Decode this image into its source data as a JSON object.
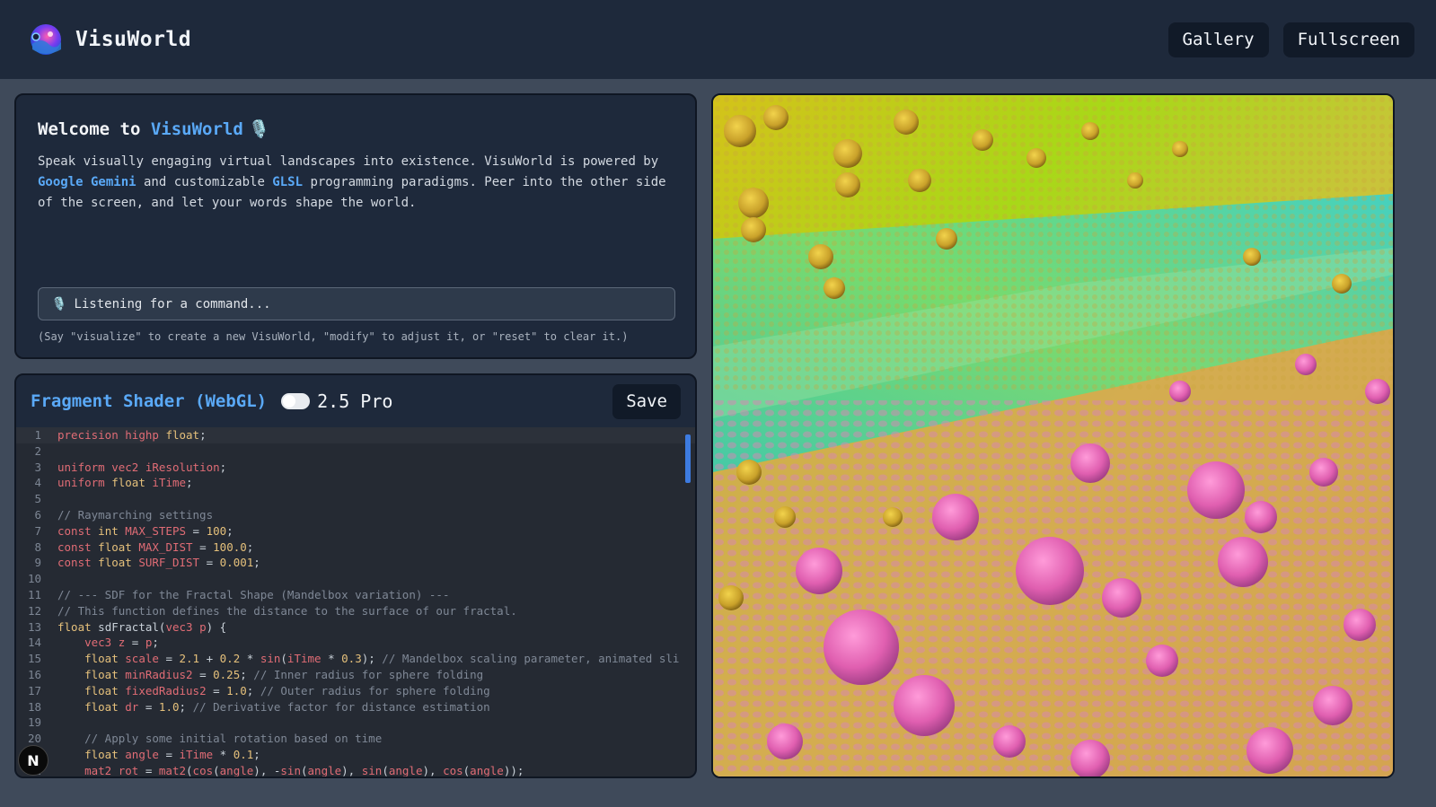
{
  "header": {
    "app_name": "VisuWorld",
    "gallery_label": "Gallery",
    "fullscreen_label": "Fullscreen"
  },
  "welcome": {
    "title_prefix": "Welcome to ",
    "title_accent": "VisuWorld",
    "title_emoji": "🎙️",
    "text_1": "Speak visually engaging virtual landscapes into existence. VisuWorld is powered by ",
    "link_1": "Google Gemini",
    "text_2": " and customizable ",
    "link_2": "GLSL",
    "text_3": " programming paradigms. Peer into the other side of the screen, and let your words shape the world.",
    "status_icon": "🎙️",
    "status_text": "Listening for a command...",
    "hint": "(Say \"visualize\" to create a new VisuWorld, \"modify\" to adjust it, or \"reset\" to clear it.)"
  },
  "editor": {
    "title": "Fragment Shader (WebGL)",
    "model_label": "2.5 Pro",
    "save_label": "Save",
    "lines": [
      {
        "n": "1",
        "html": "<span class='kw'>precision</span> <span class='kw'>highp</span> <span class='ty'>float</span>;"
      },
      {
        "n": "2",
        "html": ""
      },
      {
        "n": "3",
        "html": "<span class='kw'>uniform</span> <span class='kw'>vec2</span> <span class='kw'>iResolution</span>;"
      },
      {
        "n": "4",
        "html": "<span class='kw'>uniform</span> <span class='ty'>float</span> <span class='kw'>iTime</span>;"
      },
      {
        "n": "5",
        "html": ""
      },
      {
        "n": "6",
        "html": "<span class='cm'>// Raymarching settings</span>"
      },
      {
        "n": "7",
        "html": "<span class='kw'>const</span> <span class='ty'>int</span> <span class='kw'>MAX_STEPS</span> = <span class='nm'>100</span>;"
      },
      {
        "n": "8",
        "html": "<span class='kw'>const</span> <span class='ty'>float</span> <span class='kw'>MAX_DIST</span> = <span class='nm'>100.0</span>;"
      },
      {
        "n": "9",
        "html": "<span class='kw'>const</span> <span class='ty'>float</span> <span class='kw'>SURF_DIST</span> = <span class='nm'>0.001</span>;"
      },
      {
        "n": "10",
        "html": ""
      },
      {
        "n": "11",
        "html": "<span class='cm'>// --- SDF for the Fractal Shape (Mandelbox variation) ---</span>"
      },
      {
        "n": "12",
        "html": "<span class='cm'>// This function defines the distance to the surface of our fractal.</span>"
      },
      {
        "n": "13",
        "html": "<span class='ty'>float</span> sdFractal(<span class='kw'>vec3</span> <span class='kw'>p</span>) {"
      },
      {
        "n": "14",
        "html": "    <span class='kw'>vec3</span> <span class='kw'>z</span> = <span class='kw'>p</span>;"
      },
      {
        "n": "15",
        "html": "    <span class='ty'>float</span> <span class='kw'>scale</span> = <span class='nm'>2.1</span> + <span class='nm'>0.2</span> * <span class='kw'>sin</span>(<span class='kw'>iTime</span> * <span class='nm'>0.3</span>); <span class='cm'>// Mandelbox scaling parameter, animated sli</span>"
      },
      {
        "n": "16",
        "html": "    <span class='ty'>float</span> <span class='kw'>minRadius2</span> = <span class='nm'>0.25</span>; <span class='cm'>// Inner radius for sphere folding</span>"
      },
      {
        "n": "17",
        "html": "    <span class='ty'>float</span> <span class='kw'>fixedRadius2</span> = <span class='nm'>1.0</span>; <span class='cm'>// Outer radius for sphere folding</span>"
      },
      {
        "n": "18",
        "html": "    <span class='ty'>float</span> <span class='kw'>dr</span> = <span class='nm'>1.0</span>; <span class='cm'>// Derivative factor for distance estimation</span>"
      },
      {
        "n": "19",
        "html": ""
      },
      {
        "n": "20",
        "html": "    <span class='cm'>// Apply some initial rotation based on time</span>"
      },
      {
        "n": "21",
        "html": "    <span class='ty'>float</span> <span class='kw'>angle</span> = <span class='kw'>iTime</span> * <span class='nm'>0.1</span>;"
      },
      {
        "n": "22",
        "html": "    <span class='kw'>mat2</span> <span class='kw'>rot</span> = <span class='kw'>mat2</span>(<span class='kw'>cos</span>(<span class='kw'>angle</span>), -<span class='kw'>sin</span>(<span class='kw'>angle</span>), <span class='kw'>sin</span>(<span class='kw'>angle</span>), <span class='kw'>cos</span>(<span class='kw'>angle</span>));"
      }
    ]
  },
  "badge": {
    "letter": "N"
  },
  "colors": {
    "accent": "#5aa9f7",
    "panel": "#1e293b",
    "page": "#3f4a5a"
  }
}
